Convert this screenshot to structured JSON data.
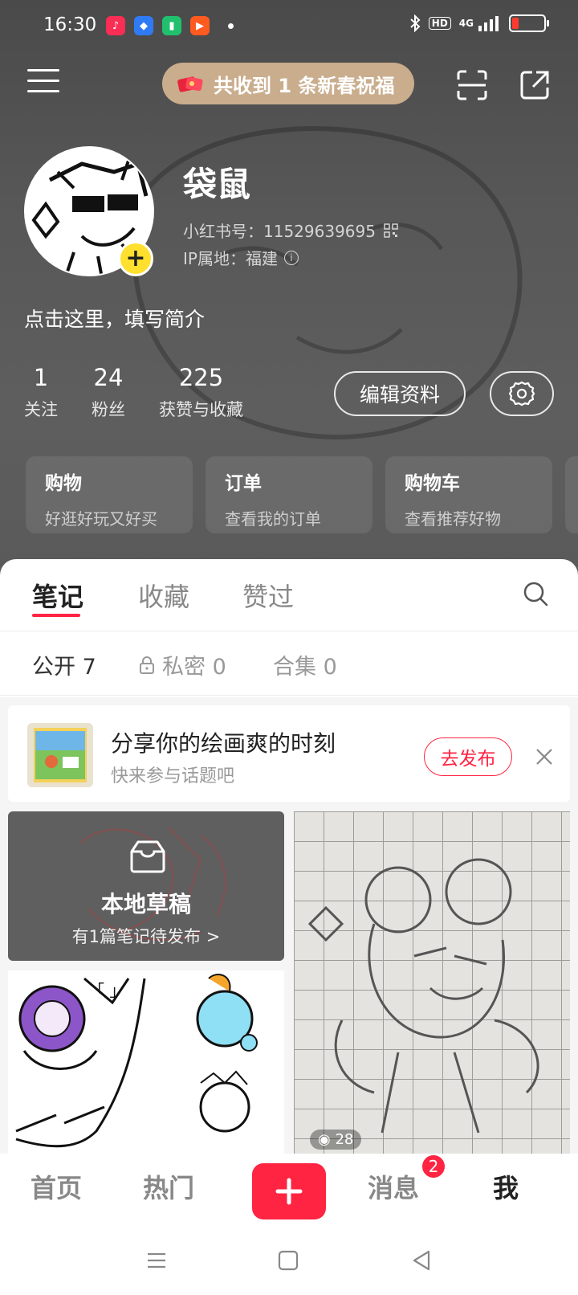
{
  "status_bar": {
    "time": "16:30",
    "network": "4G",
    "hd": "HD",
    "battery_level": 0.18
  },
  "header": {
    "greeting": "共收到 1 条新春祝福"
  },
  "profile": {
    "nickname": "袋鼠",
    "red_id": "小红书号：11529639695",
    "ip_location": "IP属地：福建",
    "bio": "点击这里，填写简介",
    "stats": [
      {
        "num": "1",
        "label": "关注"
      },
      {
        "num": "24",
        "label": "粉丝"
      },
      {
        "num": "225",
        "label": "获赞与收藏"
      }
    ],
    "edit_label": "编辑资料"
  },
  "services": [
    {
      "title": "购物",
      "sub": "好逛好玩又好买"
    },
    {
      "title": "订单",
      "sub": "查看我的订单"
    },
    {
      "title": "购物车",
      "sub": "查看推荐好物"
    }
  ],
  "tabs": [
    "笔记",
    "收藏",
    "赞过"
  ],
  "subtabs": [
    "公开 7",
    "私密 0",
    "合集 0"
  ],
  "promo": {
    "title": "分享你的绘画爽的时刻",
    "subtitle": "快来参与话题吧",
    "button": "去发布"
  },
  "draft": {
    "title": "本地草稿",
    "subtitle": "有1篇笔记待发布 >"
  },
  "note_right": {
    "views": "28"
  },
  "bottom_nav": {
    "home": "首页",
    "hot": "热门",
    "messages": "消息",
    "messages_badge": "2",
    "me": "我"
  },
  "colors": {
    "accent": "#ff2442",
    "greeting_pill": "#c9ad8d",
    "avatar_add": "#ffe02e"
  }
}
